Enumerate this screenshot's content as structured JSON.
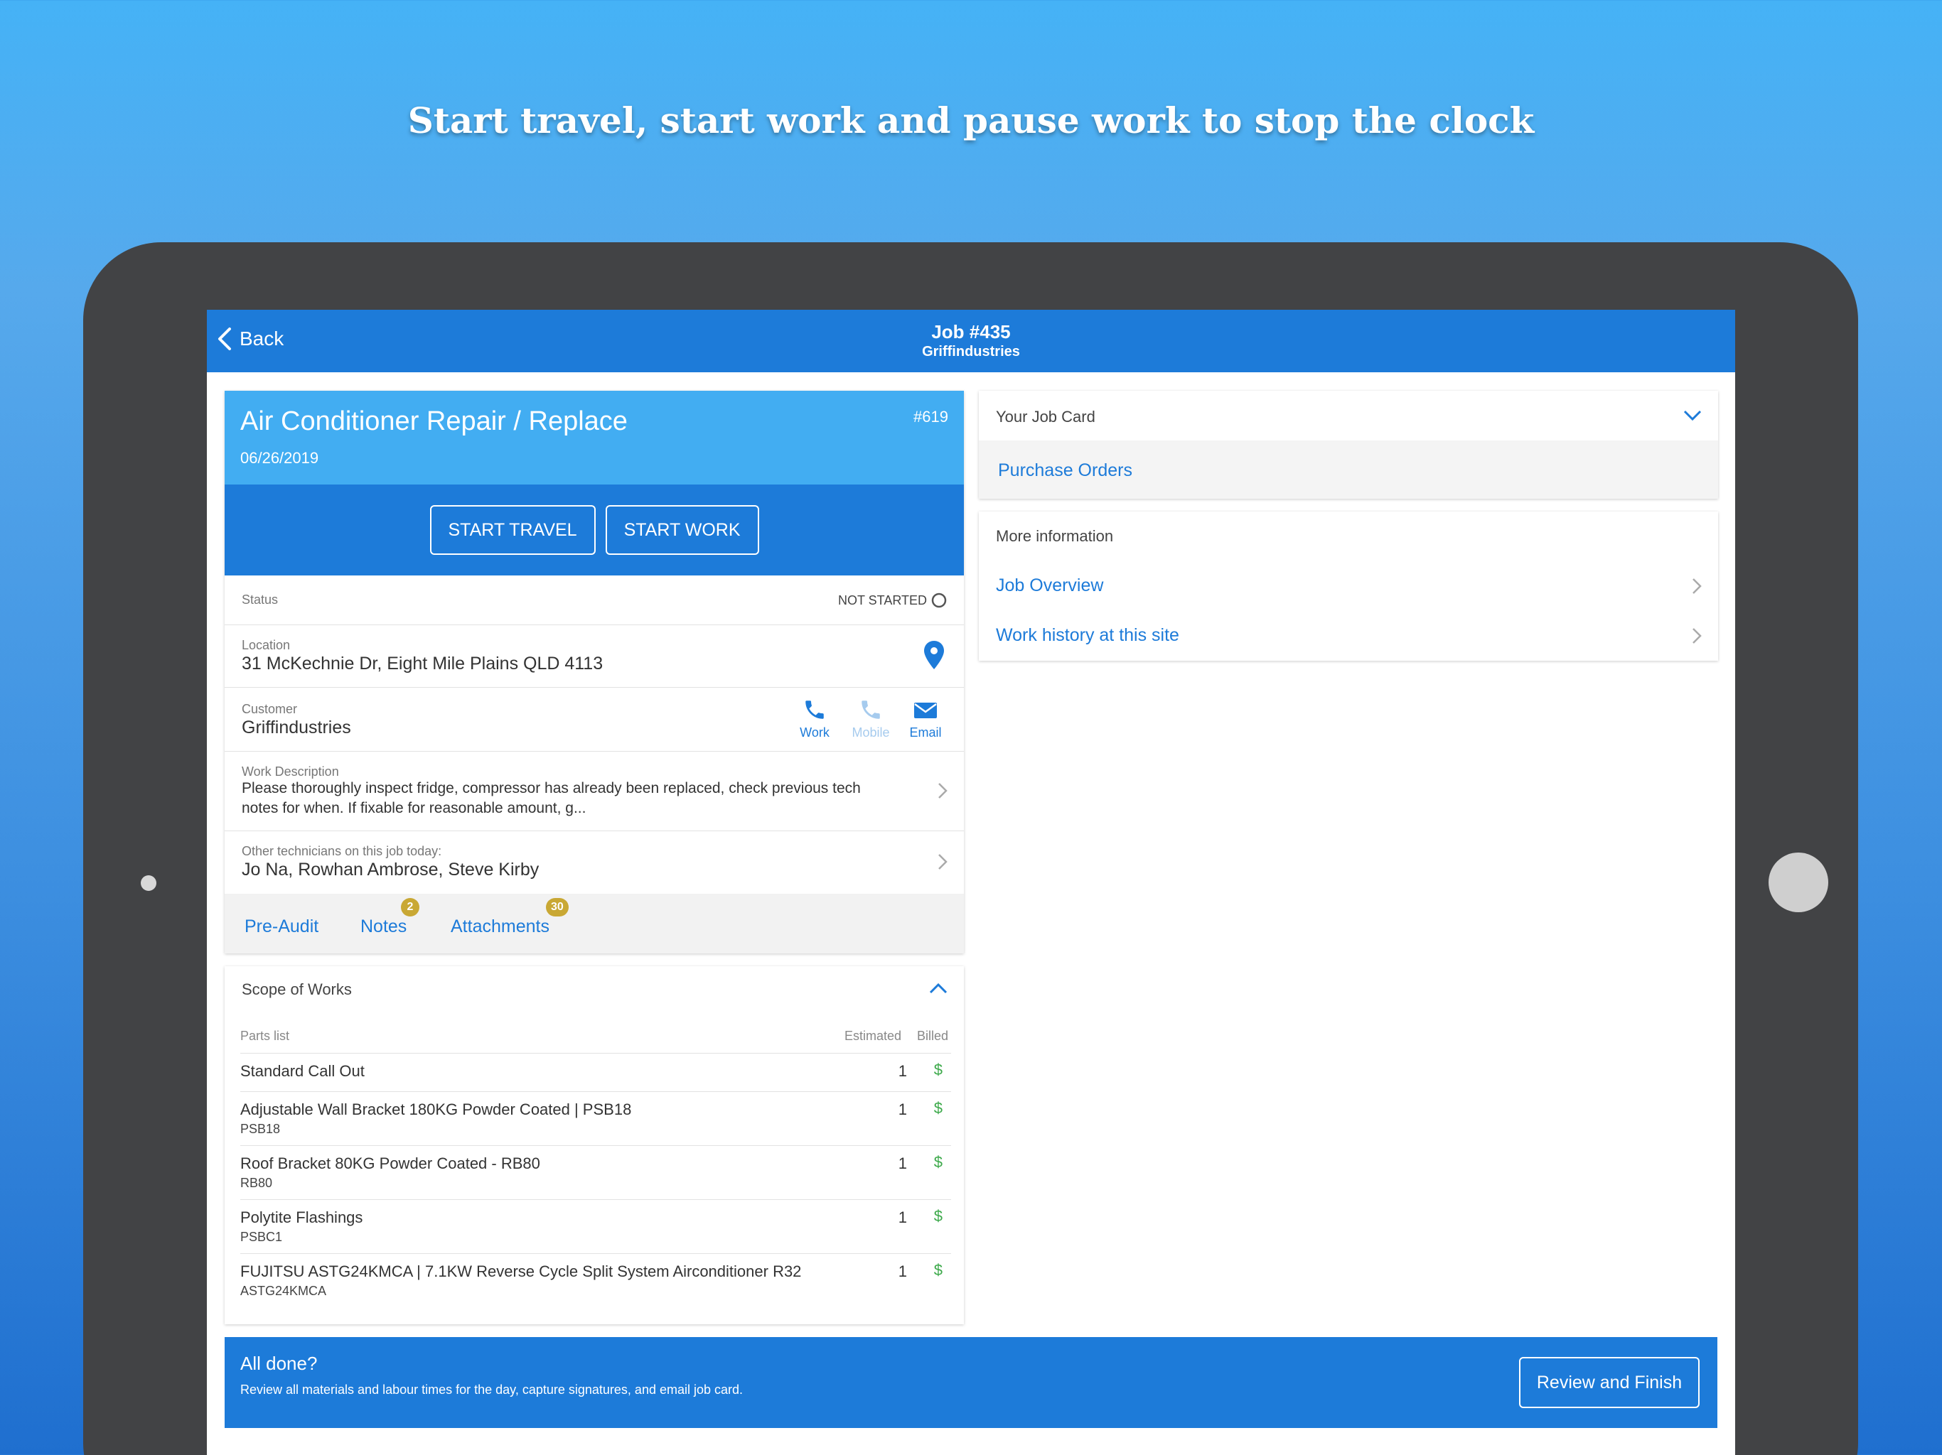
{
  "headline": "Start travel, start work and pause work to stop the clock",
  "topbar": {
    "back_label": "Back",
    "title": "Job #435",
    "subtitle": "Griffindustries"
  },
  "job": {
    "title": "Air Conditioner Repair / Replace",
    "date": "06/26/2019",
    "number": "#619",
    "start_travel": "START TRAVEL",
    "start_work": "START WORK"
  },
  "status": {
    "label": "Status",
    "value": "NOT STARTED"
  },
  "location": {
    "label": "Location",
    "value": "31 McKechnie Dr, Eight Mile Plains QLD 4113"
  },
  "customer": {
    "label": "Customer",
    "value": "Griffindustries",
    "work": "Work",
    "mobile": "Mobile",
    "email": "Email"
  },
  "work_description": {
    "label": "Work Description",
    "line1": "Please thoroughly inspect fridge, compressor has already been replaced, check previous tech",
    "line2": "notes for when.  If fixable for reasonable amount, g..."
  },
  "technicians": {
    "label": "Other technicians on this job today:",
    "value": "Jo Na, Rowhan Ambrose, Steve Kirby"
  },
  "tabs": {
    "pre_audit": "Pre-Audit",
    "notes": "Notes",
    "notes_count": "2",
    "attachments": "Attachments",
    "attachments_count": "30"
  },
  "scope": {
    "title": "Scope of Works",
    "parts_label": "Parts list",
    "estimated_label": "Estimated",
    "billed_label": "Billed",
    "parts": [
      {
        "name": "Standard Call Out",
        "code": "",
        "qty": "1",
        "billed": "$"
      },
      {
        "name": "Adjustable Wall Bracket 180KG Powder Coated | PSB18",
        "code": "PSB18",
        "qty": "1",
        "billed": "$"
      },
      {
        "name": "Roof Bracket 80KG Powder Coated - RB80",
        "code": "RB80",
        "qty": "1",
        "billed": "$"
      },
      {
        "name": "Polytite Flashings",
        "code": "PSBC1",
        "qty": "1",
        "billed": "$"
      },
      {
        "name": "FUJITSU ASTG24KMCA | 7.1KW Reverse Cycle Split System Airconditioner R32",
        "code": "ASTG24KMCA",
        "qty": "1",
        "billed": "$"
      }
    ]
  },
  "job_card": {
    "title": "Your Job Card",
    "purchase_orders": "Purchase Orders"
  },
  "more_info": {
    "title": "More information",
    "job_overview": "Job Overview",
    "work_history": "Work history at this site"
  },
  "footer": {
    "heading": "All done?",
    "subtext": "Review all materials and labour times for the day, capture signatures, and email job card.",
    "button": "Review and Finish"
  },
  "colors": {
    "primary": "#1d7bd9",
    "header_light": "#42adf2",
    "billed_green": "#3ca94a",
    "badge": "#c9a834",
    "device": "#424345"
  }
}
